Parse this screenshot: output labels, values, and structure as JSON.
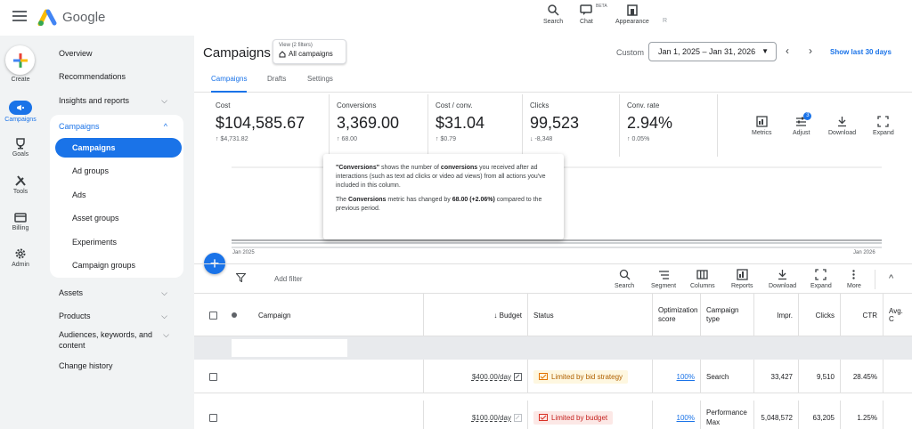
{
  "topbar": {
    "app_name": "Google",
    "tools": [
      {
        "label": "Search",
        "icon": "search-icon"
      },
      {
        "label": "Chat",
        "icon": "chat-icon",
        "badge": "BETA"
      },
      {
        "label": "Appearance",
        "icon": "appearance-icon"
      },
      {
        "label": "R",
        "icon": "refresh-icon"
      }
    ]
  },
  "rail": {
    "items": [
      {
        "label": "Create",
        "icon": "plus-icon"
      },
      {
        "label": "Campaigns",
        "icon": "campaigns-icon",
        "active": true
      },
      {
        "label": "Goals",
        "icon": "trophy-icon"
      },
      {
        "label": "Tools",
        "icon": "tools-icon"
      },
      {
        "label": "Billing",
        "icon": "billing-icon"
      },
      {
        "label": "Admin",
        "icon": "gear-icon"
      }
    ]
  },
  "nav": {
    "overview": "Overview",
    "recommendations": "Recommendations",
    "insights": "Insights and reports",
    "campaigns_group": "Campaigns",
    "sub": [
      "Campaigns",
      "Ad groups",
      "Ads",
      "Asset groups",
      "Experiments",
      "Campaign groups"
    ],
    "assets": "Assets",
    "products": "Products",
    "audiences": "Audiences, keywords, and content",
    "change_history": "Change history"
  },
  "header": {
    "title": "Campaigns",
    "view_line1": "View (2 filters)",
    "view_line2": "All campaigns",
    "custom_label": "Custom",
    "date_range": "Jan 1, 2025 – Jan 31, 2026",
    "show_last": "Show last 30 days"
  },
  "tabs": [
    "Campaigns",
    "Drafts",
    "Settings"
  ],
  "metrics": [
    {
      "label": "Cost",
      "value": "$104,585.67",
      "change": "↑ $4,731.82"
    },
    {
      "label": "Conversions",
      "value": "3,369.00",
      "change": "↑ 68.00"
    },
    {
      "label": "Cost / conv.",
      "value": "$31.04",
      "change": "↑ $0.79"
    },
    {
      "label": "Clicks",
      "value": "99,523",
      "change": "↓ -8,348"
    },
    {
      "label": "Conv. rate",
      "value": "2.94%",
      "change": "↑ 0.05%"
    }
  ],
  "metric_tools": [
    {
      "label": "Metrics",
      "icon": "metrics-icon"
    },
    {
      "label": "Adjust",
      "icon": "adjust-icon",
      "badge": "3"
    },
    {
      "label": "Download",
      "icon": "download-icon"
    },
    {
      "label": "Expand",
      "icon": "expand-icon"
    }
  ],
  "chart": {
    "x_start": "Jan 2025",
    "x_end": "Jan 2026"
  },
  "tooltip": {
    "p1_a": "\"Conversions\"",
    "p1_b": " shows the number of ",
    "p1_c": "conversions",
    "p1_d": " you received after ad interactions (such as text ad clicks or video ad views) from all actions you've included in this column.",
    "p2_a": "The ",
    "p2_b": "Conversions",
    "p2_c": " metric has changed by ",
    "p2_d": "68.00 (+2.06%)",
    "p2_e": " compared to the previous period."
  },
  "filter": {
    "add_filter": "Add filter",
    "tools": [
      {
        "label": "Search",
        "icon": "search-icon"
      },
      {
        "label": "Segment",
        "icon": "segment-icon"
      },
      {
        "label": "Columns",
        "icon": "columns-icon"
      },
      {
        "label": "Reports",
        "icon": "reports-icon"
      },
      {
        "label": "Download",
        "icon": "download-icon"
      },
      {
        "label": "Expand",
        "icon": "expand-icon"
      },
      {
        "label": "More",
        "icon": "more-icon"
      }
    ]
  },
  "table": {
    "headers": {
      "campaign": "Campaign",
      "budget": "↓ Budget",
      "status": "Status",
      "opt": "Optimization score",
      "type": "Campaign type",
      "impr": "Impr.",
      "clicks": "Clicks",
      "ctr": "CTR",
      "avg": "Avg. C"
    },
    "rows": [
      {
        "budget": "$400.00/day",
        "status": "Limited by bid strategy",
        "status_kind": "warn",
        "opt": "100%",
        "type": "Search",
        "impr": "33,427",
        "clicks": "9,510",
        "ctr": "28.45%"
      },
      {
        "budget": "$100.00/day",
        "status": "Limited by budget",
        "status_kind": "err",
        "opt": "100%",
        "type": "Performance Max",
        "impr": "5,048,572",
        "clicks": "63,205",
        "ctr": "1.25%"
      }
    ]
  }
}
